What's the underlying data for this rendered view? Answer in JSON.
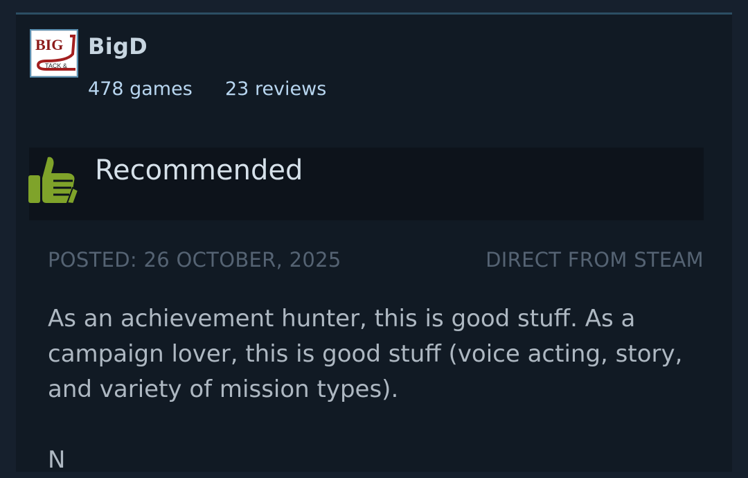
{
  "author": {
    "name": "BigD",
    "games_count": "478 games",
    "reviews_count": "23 reviews",
    "avatar": {
      "icon": "bigd-tack-logo",
      "text_top": "BIG",
      "text_bottom": "TACK &"
    }
  },
  "verdict": {
    "label": "Recommended",
    "icon": "thumbs-up-icon",
    "icon_color": "#7fa32a"
  },
  "meta": {
    "posted": "Posted: 26 October, 2025",
    "source": "Direct from Steam"
  },
  "review": {
    "text": "As an achievement hunter, this is good stuff. As a campaign lover, this is good stuff (voice acting, story, and variety of mission types).",
    "more": "N"
  }
}
